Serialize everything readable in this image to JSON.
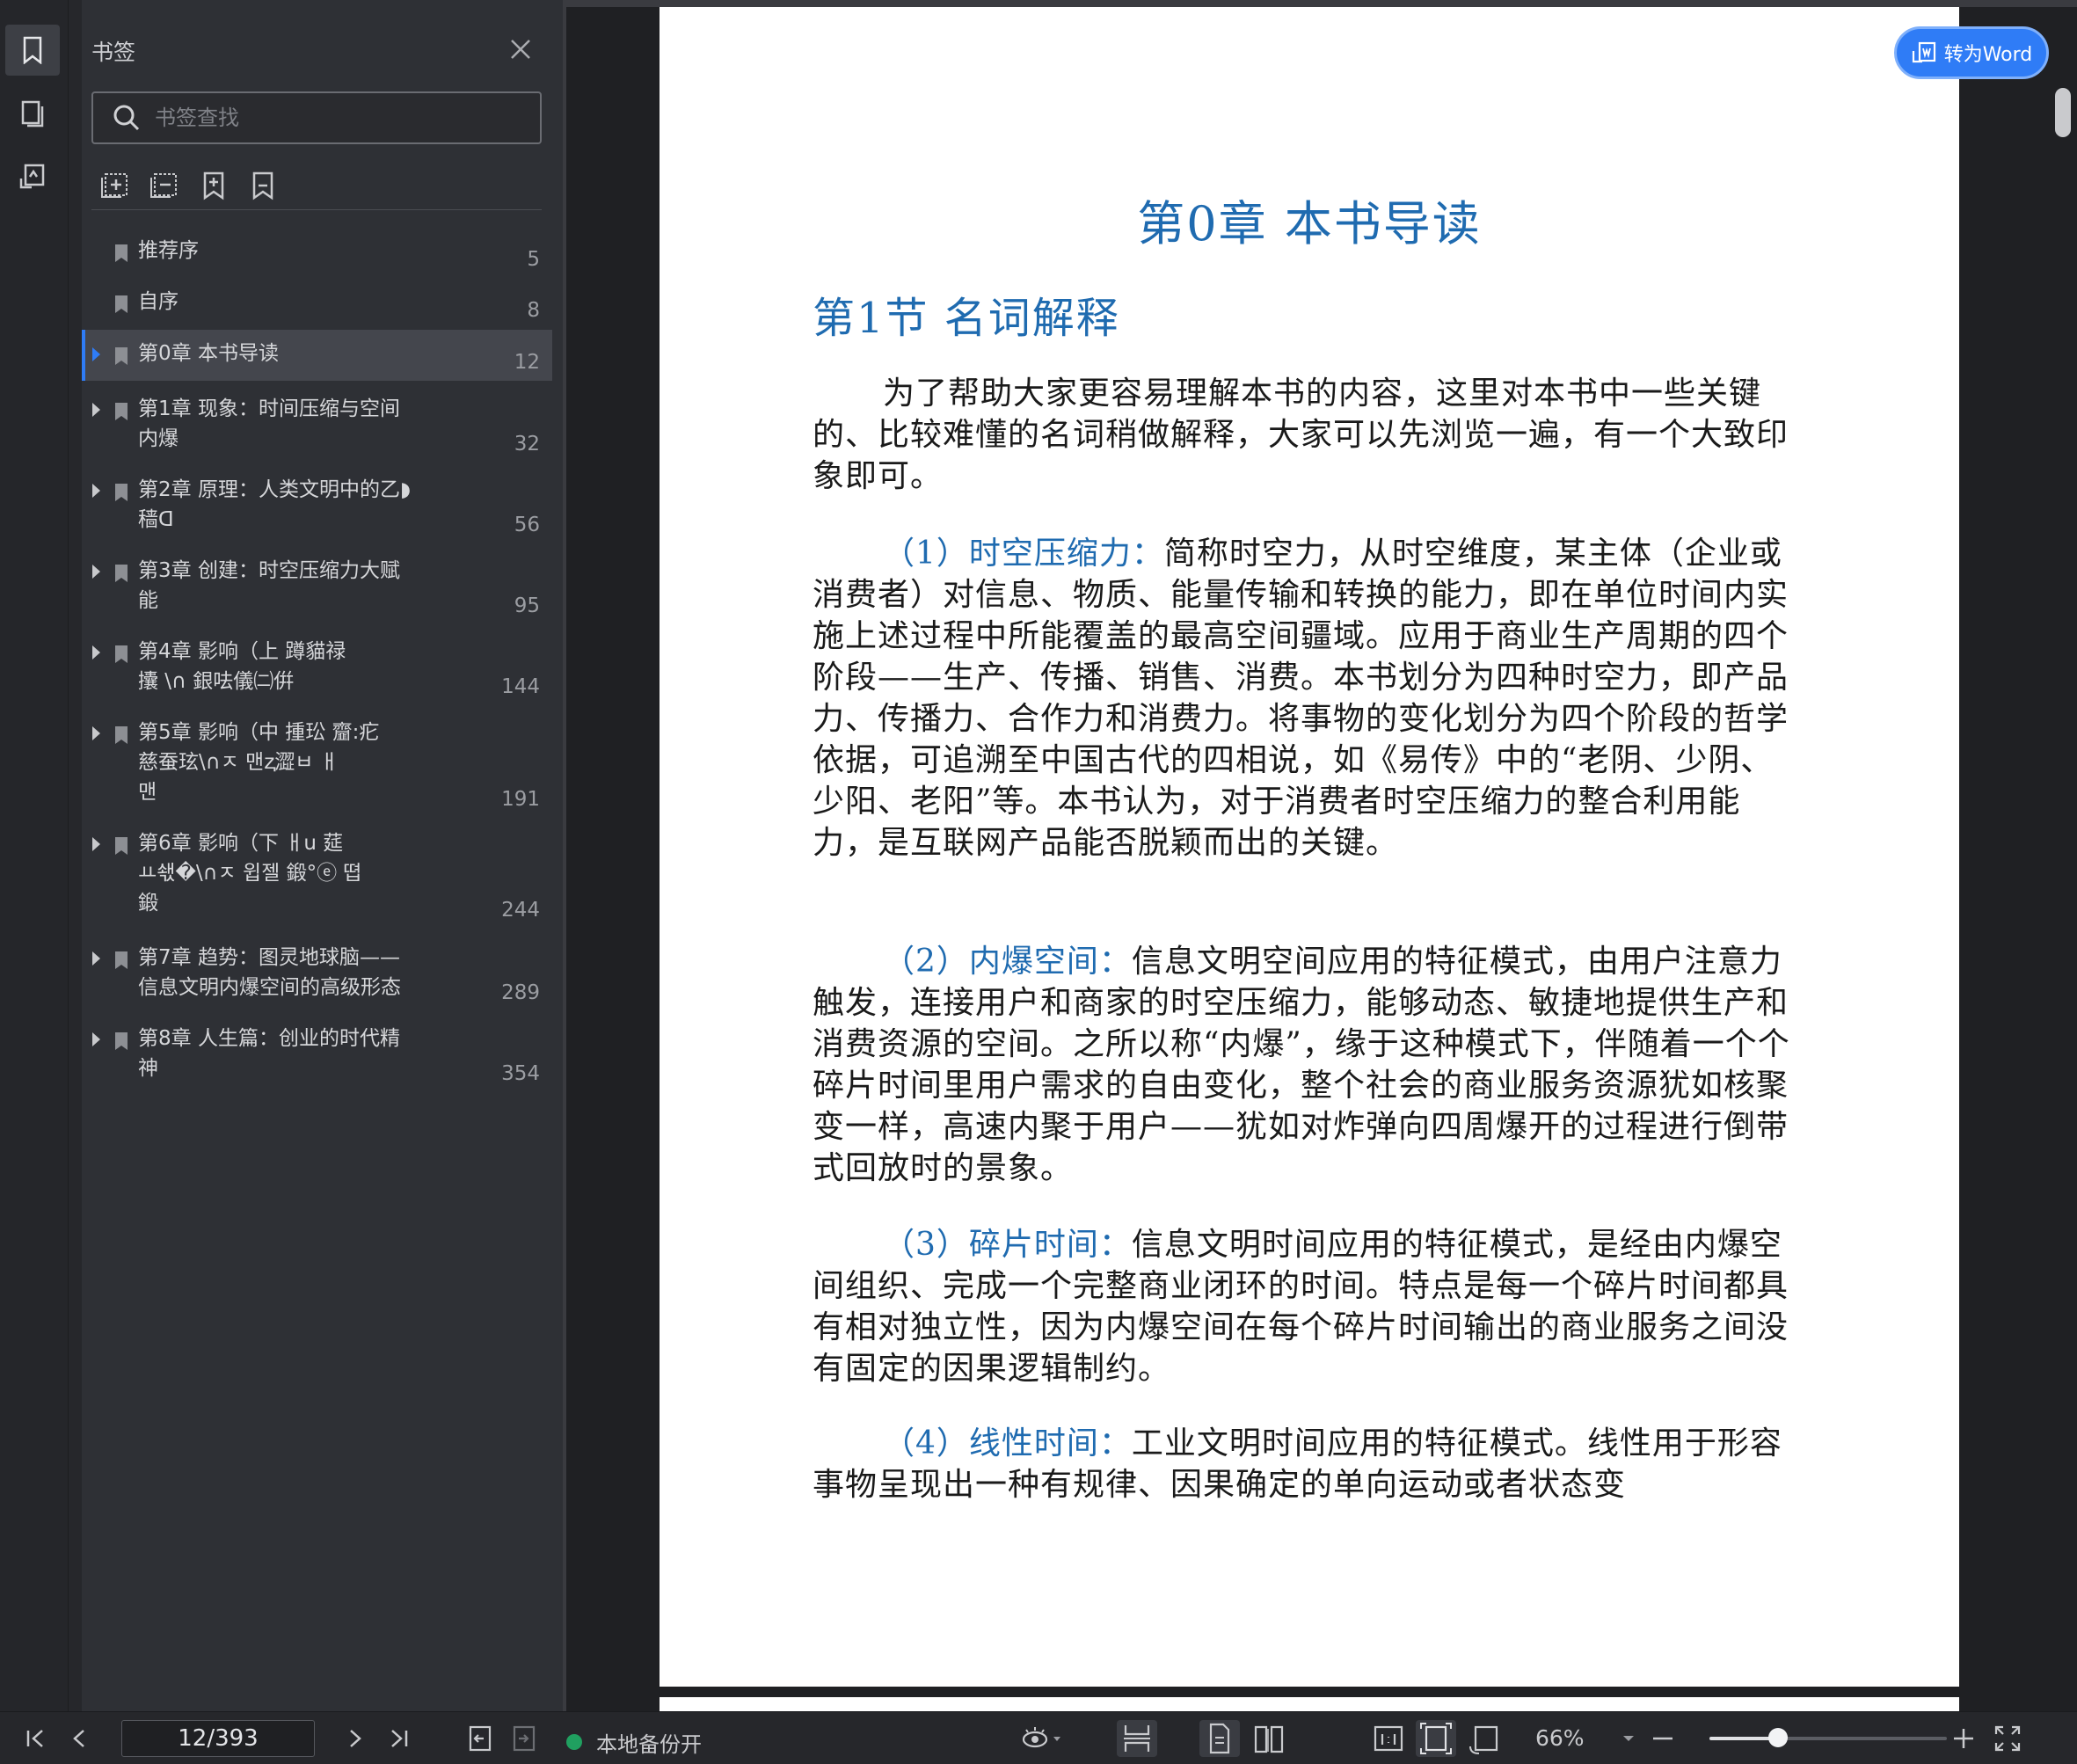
{
  "panel": {
    "title": "书签",
    "search_placeholder": "书签查找"
  },
  "bookmarks": [
    {
      "label": "推荐序",
      "page": "5",
      "has_children": false,
      "active": false
    },
    {
      "label": "自序",
      "page": "8",
      "has_children": false,
      "active": false
    },
    {
      "label": "第0章 本书导读",
      "page": "12",
      "has_children": true,
      "active": true
    },
    {
      "label": "第1章 现象：时间压缩与空间\n内爆",
      "page": "32",
      "has_children": true,
      "active": false
    },
    {
      "label": "第2章 原理：人类文明中的乙◗\n   穑ᗡ",
      "page": "56",
      "has_children": true,
      "active": false
    },
    {
      "label": "第3章 创建：时空压缩力大赋\n能",
      "page": "95",
      "has_children": true,
      "active": false
    },
    {
      "label": "第4章 影响（上          蹲貓禄\n攮  \\∩       銀呿儀㈡倂",
      "page": "144",
      "has_children": true,
      "active": false
    },
    {
      "label": "第5章 影响（中    揰玜     齏:疕\n慈蚕玹\\∩ㅈ          맨ⱬ澀ㅂ   ㅐ\n   맨",
      "page": "191",
      "has_children": true,
      "active": false
    },
    {
      "label": "第6章 影响（下   ㅐu        莚\n   ㅛ쇇�\\∩ㅈ    윕젤     鍛°ⓔ     뗩\n   鍛",
      "page": "244",
      "has_children": true,
      "active": false
    },
    {
      "label": "第7章 趋势：图灵地球脑——\n信息文明内爆空间的高级形态",
      "page": "289",
      "has_children": true,
      "active": false
    },
    {
      "label": "第8章 人生篇：创业的时代精\n神",
      "page": "354",
      "has_children": true,
      "active": false
    }
  ],
  "document": {
    "chapter_title": "第0章    本书导读",
    "section_title": "第1节    名词解释",
    "intro": "为了帮助大家更容易理解本书的内容，这里对本书中一些关键的、比较难懂的名词稍做解释，大家可以先浏览一遍，有一个大致印象即可。",
    "items": [
      {
        "term": "（1）时空压缩力：",
        "text": "简称时空力，从时空维度，某主体（企业或消费者）对信息、物质、能量传输和转换的能力，即在单位时间内实施上述过程中所能覆盖的最高空间疆域。应用于商业生产周期的四个阶段——生产、传播、销售、消费。本书划分为四种时空力，即产品力、传播力、合作力和消费力。将事物的变化划分为四个阶段的哲学依据，可追溯至中国古代的四相说，如《易传》中的“老阴、少阴、少阳、老阳”等。本书认为，对于消费者时空压缩力的整合利用能力，是互联网产品能否脱颖而出的关键。"
      },
      {
        "term": "（2）内爆空间：",
        "text": "信息文明空间应用的特征模式，由用户注意力触发，连接用户和商家的时空压缩力，能够动态、敏捷地提供生产和消费资源的空间。之所以称“内爆”，缘于这种模式下，伴随着一个个碎片时间里用户需求的自由变化，整个社会的商业服务资源犹如核聚变一样，高速内聚于用户——犹如对炸弹向四周爆开的过程进行倒带式回放时的景象。"
      },
      {
        "term": "（3）碎片时间：",
        "text": "信息文明时间应用的特征模式，是经由内爆空间组织、完成一个完整商业闭环的时间。特点是每一个碎片时间都具有相对独立性，因为内爆空间在每个碎片时间输出的商业服务之间没有固定的因果逻辑制约。"
      },
      {
        "term": "（4）线性时间：",
        "text": "工业文明时间应用的特征模式。线性用于形容事物呈现出一种有规律、因果确定的单向运动或者状态变"
      }
    ],
    "convert_button": "转为Word"
  },
  "statusbar": {
    "page_indicator": "12/393",
    "backup_label": "本地备份开",
    "zoom": "66%",
    "zoom_fraction": 0.29
  },
  "colors": {
    "accent": "#2f7cf6",
    "heading_blue": "#1f6bb0",
    "backup_on": "#20a060"
  }
}
